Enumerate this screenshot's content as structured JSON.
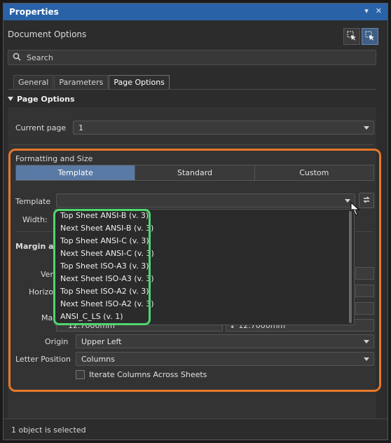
{
  "panel": {
    "title": "Properties",
    "title_controls": [
      "▾",
      "✕"
    ],
    "document_title": "Document Options"
  },
  "search": {
    "placeholder": "Search"
  },
  "tabs": [
    {
      "label": "General",
      "active": false
    },
    {
      "label": "Parameters",
      "active": false
    },
    {
      "label": "Page Options",
      "active": true
    }
  ],
  "page_options": {
    "section_title": "Page Options",
    "current_page_label": "Current page",
    "current_page_value": "1"
  },
  "formatting": {
    "title": "Formatting and Size",
    "segments": [
      {
        "label": "Template",
        "active": true
      },
      {
        "label": "Standard",
        "active": false
      },
      {
        "label": "Custom",
        "active": false
      }
    ],
    "template_label": "Template",
    "template_value": "",
    "width_label": "Width:",
    "template_options": [
      "Top Sheet ANSI-B (v. 3)",
      "Next Sheet ANSI-B (v. 3)",
      "Top Sheet ANSI-C (v. 3)",
      "Next Sheet ANSI-C (v. 3)",
      "Top Sheet ISO-A3 (v. 3)",
      "Next Sheet ISO-A3 (v. 3)",
      "Top Sheet ISO-A2 (v. 3)",
      "Next Sheet ISO-A2 (v. 3)",
      "ANSI_C_LS (v. 1)"
    ]
  },
  "margin": {
    "title_partial": "Margin an",
    "row_labels_partial": [
      "Ver",
      "Horizo",
      "Ma"
    ],
    "margin_value_left": "12.7000mm",
    "margin_value_right": "12.7000mm",
    "origin_label": "Origin",
    "origin_value": "Upper Left",
    "letter_position_label": "Letter Position",
    "letter_position_value": "Columns",
    "iterate_label": "Iterate Columns Across Sheets"
  },
  "status": {
    "text": "1 object is selected"
  },
  "colors": {
    "title_bar": "#2a62a8",
    "highlight_orange": "#e6772a",
    "highlight_green": "#4fd66e",
    "active_segment": "#5a7aa6"
  }
}
